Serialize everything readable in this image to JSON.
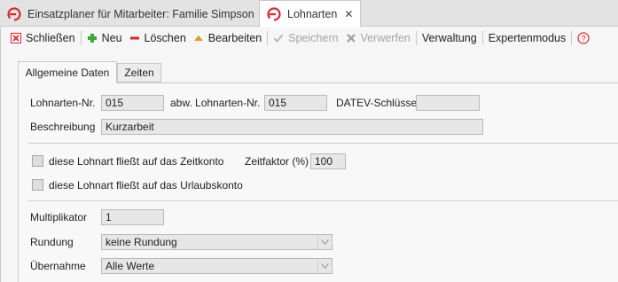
{
  "tabs": [
    {
      "label": "Einsatzplaner für Mitarbeiter: Familie Simpson",
      "icon": "app-logo-icon",
      "active": false
    },
    {
      "label": "Lohnarten",
      "icon": "app-logo-icon",
      "active": true,
      "close": "✕"
    }
  ],
  "toolbar": {
    "close_label": "Schließen",
    "new_label": "Neu",
    "delete_label": "Löschen",
    "edit_label": "Bearbeiten",
    "save_label": "Speichern",
    "discard_label": "Verwerfen",
    "admin_label": "Verwaltung",
    "expert_label": "Expertenmodus",
    "help_glyph": "?"
  },
  "panel_tabs": [
    "Allgemeine Daten",
    "Zeiten"
  ],
  "form": {
    "lohnart_nr_label": "Lohnarten-Nr.",
    "lohnart_nr_value": "015",
    "abw_nr_label": "abw. Lohnarten-Nr.",
    "abw_nr_value": "015",
    "datev_label": "DATEV-Schlüssel",
    "datev_value": "",
    "beschreibung_label": "Beschreibung",
    "beschreibung_value": "Kurzarbeit",
    "zeitkonto_label": "diese Lohnart fließt auf das Zeitkonto",
    "zeitkonto_checked": false,
    "zeitfaktor_label": "Zeitfaktor (%)",
    "zeitfaktor_value": "100",
    "urlaubskonto_label": "diese Lohnart fließt auf das Urlaubskonto",
    "urlaubskonto_checked": false,
    "multiplikator_label": "Multiplikator",
    "multiplikator_value": "1",
    "rundung_label": "Rundung",
    "rundung_value": "keine Rundung",
    "uebernahme_label": "Übernahme",
    "uebernahme_value": "Alle Werte"
  },
  "colors": {
    "brand_red": "#d9272e",
    "add_green": "#3aa83a",
    "edit_orange": "#e39a1c",
    "disabled_gray": "#a5a5a5"
  }
}
